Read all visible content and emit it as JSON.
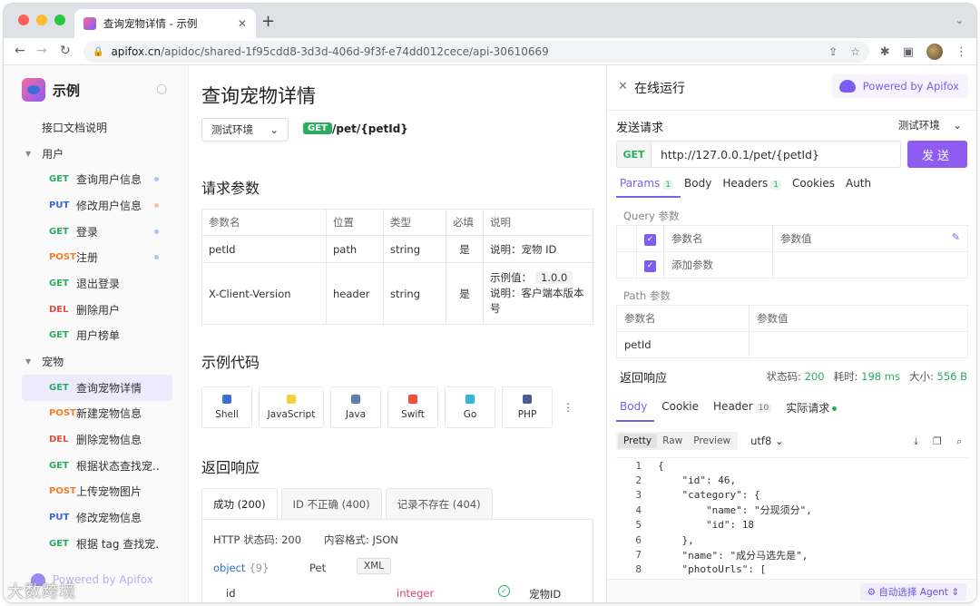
{
  "browser": {
    "tab_title": "查询宠物详情 - 示例",
    "url_host": "apifox.cn",
    "url_path": "/apidoc/shared-1f95cdd8-3d3d-406d-9f3f-e74dd012cece/api-30610669"
  },
  "sidebar": {
    "brand": "示例",
    "items": [
      {
        "kind": "doc",
        "label": "接口文档说明"
      },
      {
        "kind": "folder",
        "label": "用户"
      },
      {
        "kind": "api",
        "method": "GET",
        "label": "查询用户信息",
        "dot": "blue"
      },
      {
        "kind": "api",
        "method": "PUT",
        "label": "修改用户信息",
        "dot": "orange"
      },
      {
        "kind": "api",
        "method": "GET",
        "label": "登录",
        "dot": "blue"
      },
      {
        "kind": "api",
        "method": "POST",
        "label": "注册",
        "dot": "blue"
      },
      {
        "kind": "api",
        "method": "GET",
        "label": "退出登录"
      },
      {
        "kind": "api",
        "method": "DEL",
        "label": "删除用户"
      },
      {
        "kind": "api",
        "method": "GET",
        "label": "用户榜单"
      },
      {
        "kind": "folder",
        "label": "宠物"
      },
      {
        "kind": "api",
        "method": "GET",
        "label": "查询宠物详情",
        "active": true
      },
      {
        "kind": "api",
        "method": "POST",
        "label": "新建宠物信息"
      },
      {
        "kind": "api",
        "method": "DEL",
        "label": "删除宠物信息"
      },
      {
        "kind": "api",
        "method": "GET",
        "label": "根据状态查找宠..."
      },
      {
        "kind": "api",
        "method": "POST",
        "label": "上传宠物图片"
      },
      {
        "kind": "api",
        "method": "PUT",
        "label": "修改宠物信息"
      },
      {
        "kind": "api",
        "method": "GET",
        "label": "根据 tag 查找宠..."
      }
    ],
    "footer": "Powered by Apifox",
    "watermark": "大数跨境"
  },
  "doc": {
    "title": "查询宠物详情",
    "env": "测试环境",
    "method": "GET",
    "path": "/pet/{petId}",
    "params_title": "请求参数",
    "params_headers": [
      "参数名",
      "位置",
      "类型",
      "必填",
      "说明"
    ],
    "params_rows": [
      {
        "name": "petId",
        "in": "path",
        "type": "string",
        "required": "是",
        "desc": "说明：宠物 ID"
      },
      {
        "name": "X-Client-Version",
        "in": "header",
        "type": "string",
        "required": "是",
        "example_label": "示例值：",
        "example": "1.0.0",
        "desc": "说明：客户端本版本号"
      }
    ],
    "code_title": "示例代码",
    "langs": [
      {
        "label": "Shell",
        "color": "#3b6fd8"
      },
      {
        "label": "JavaScript",
        "color": "#f1d33a"
      },
      {
        "label": "Java",
        "color": "#5f7fa8"
      },
      {
        "label": "Swift",
        "color": "#f05138"
      },
      {
        "label": "Go",
        "color": "#2fb7d4"
      },
      {
        "label": "PHP",
        "color": "#4f5b93"
      }
    ],
    "more": "⋮",
    "resp_title": "返回响应",
    "resp_tabs": [
      "成功 (200)",
      "ID 不正确 (400)",
      "记录不存在 (404)"
    ],
    "resp_status": "HTTP 状态码: 200",
    "resp_format": "内容格式: JSON",
    "schema_type": "object",
    "schema_count": "{9}",
    "schema_name": "Pet",
    "xml": "XML",
    "field_name": "id",
    "field_type": "integer",
    "field_desc": "宠物ID"
  },
  "run": {
    "title": "在线运行",
    "powered": "Powered by Apifox",
    "send_label": "发送请求",
    "env": "测试环境",
    "method": "GET",
    "url": "http://127.0.0.1/pet/{petId}",
    "send_btn": "发送",
    "req_tabs": [
      {
        "label": "Params",
        "count": "1",
        "active": true
      },
      {
        "label": "Body"
      },
      {
        "label": "Headers",
        "count": "1"
      },
      {
        "label": "Cookies"
      },
      {
        "label": "Auth"
      }
    ],
    "query_title": "Query 参数",
    "col_name": "参数名",
    "col_value": "参数值",
    "add_param": "添加参数",
    "path_title": "Path 参数",
    "path_param": "petId",
    "resp_title": "返回响应",
    "status_label": "状态码:",
    "status_value": "200",
    "time_label": "耗时:",
    "time_value": "198 ms",
    "size_label": "大小:",
    "size_value": "556 B",
    "res_tabs": [
      {
        "label": "Body",
        "active": true
      },
      {
        "label": "Cookie"
      },
      {
        "label": "Header",
        "count": "10"
      },
      {
        "label": "实际请求",
        "dot": true
      }
    ],
    "fmt_tabs": [
      "Pretty",
      "Raw",
      "Preview"
    ],
    "encoding": "utf8",
    "code_lines": [
      "{",
      "    \"id\": 46,",
      "    \"category\": {",
      "        \"name\": \"分现须分\",",
      "        \"id\": 18",
      "    },",
      "    \"name\": \"成分马选先是\",",
      "    \"photoUrls\": ["
    ],
    "agent": "自动选择 Agent"
  },
  "colors": {
    "accent": "#7d5cf0",
    "get": "#27ae60",
    "put": "#2f6bd8",
    "post": "#f57c2b",
    "del": "#e74c3c"
  }
}
